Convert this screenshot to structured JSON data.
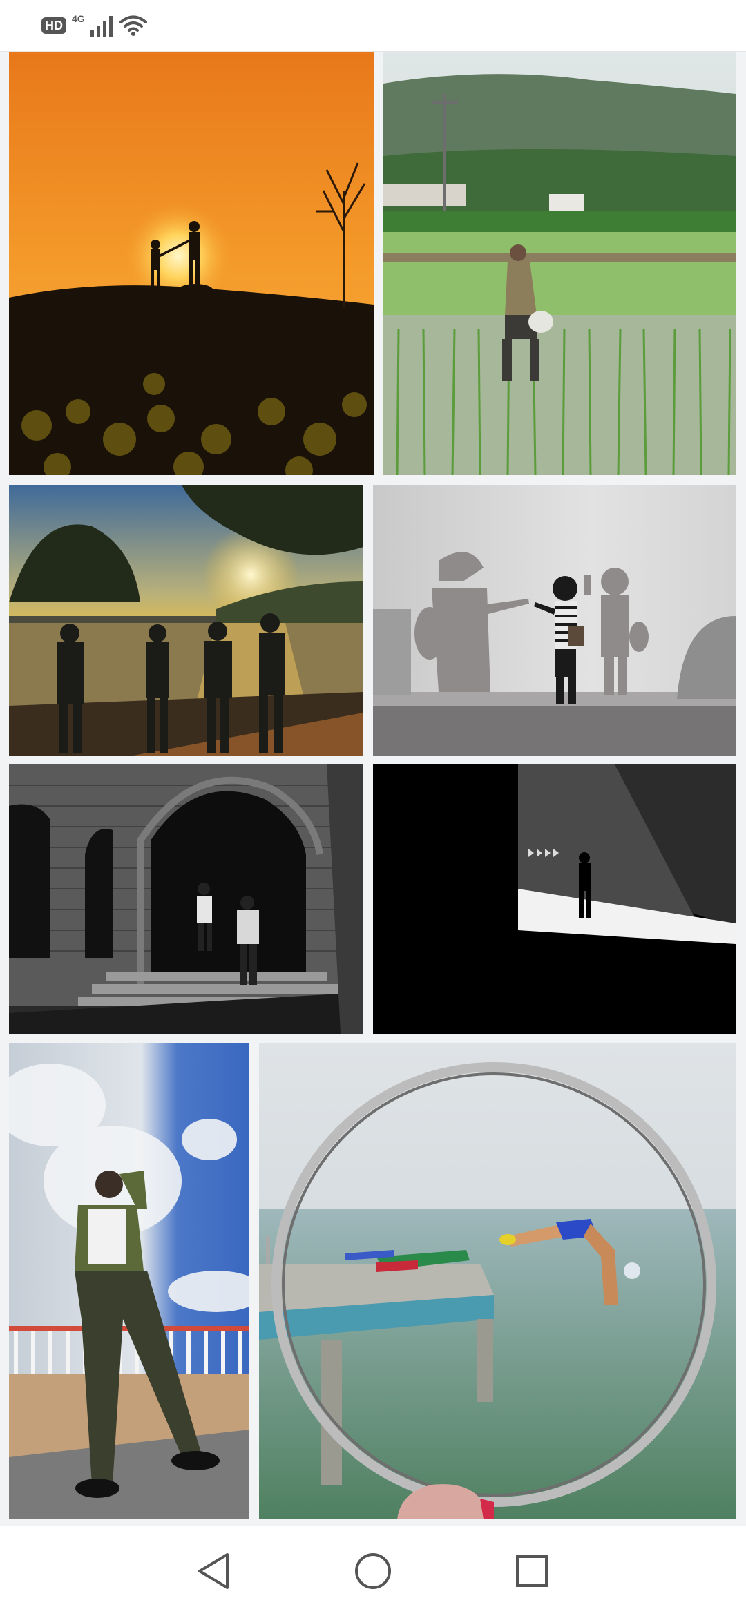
{
  "status_bar": {
    "hd_label": "HD",
    "network_label": "4G",
    "signal_icon": "signal-bars-icon",
    "wifi_icon": "wifi-icon"
  },
  "gallery": {
    "photos": [
      {
        "subject": "sunset-silhouette-hill"
      },
      {
        "subject": "farmer-rice-field"
      },
      {
        "subject": "lake-sunset-group"
      },
      {
        "subject": "shadow-play-wall"
      },
      {
        "subject": "brick-archway-bw"
      },
      {
        "subject": "tunnel-walker-bw"
      },
      {
        "subject": "man-posing-sky"
      },
      {
        "subject": "diver-through-ring"
      }
    ]
  },
  "nav_bar": {
    "back_icon": "back-triangle-icon",
    "home_icon": "home-circle-icon",
    "recents_icon": "recents-square-icon"
  },
  "colors": {
    "background": "#f2f3f5",
    "nav_icon": "#555555"
  }
}
